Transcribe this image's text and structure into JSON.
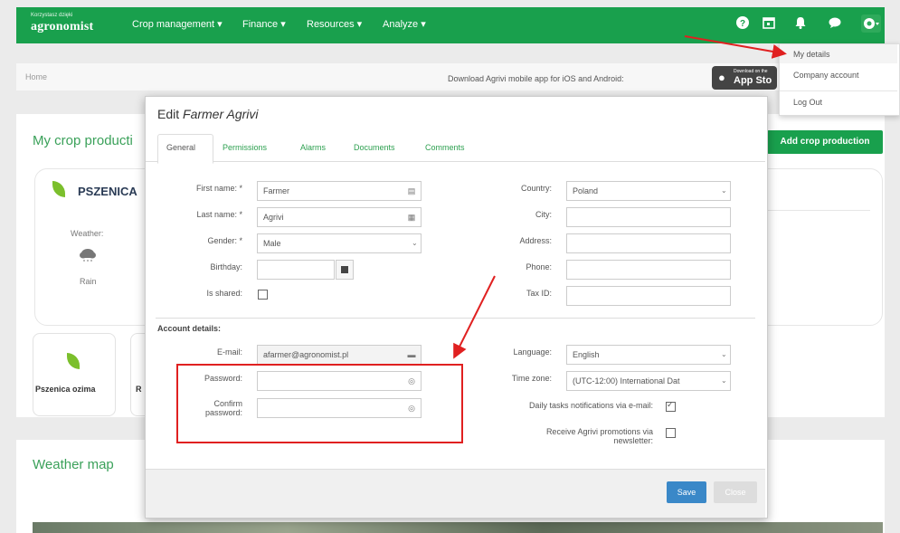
{
  "navbar": {
    "logo_small": "Korzystasz dzięki",
    "logo": "agronomist",
    "items": [
      {
        "label": "Crop management ▾"
      },
      {
        "label": "Finance ▾"
      },
      {
        "label": "Resources ▾"
      },
      {
        "label": "Analyze ▾"
      }
    ],
    "icons": [
      "help-icon",
      "calendar-icon",
      "bell-icon",
      "chat-icon",
      "gear-icon"
    ]
  },
  "user_menu": {
    "items": [
      "My details",
      "Company account",
      "Log Out"
    ]
  },
  "breadcrumb": {
    "home": "Home"
  },
  "download_bar": {
    "text": "Download Agrivi mobile app for iOS and Android:",
    "appstore_small": "Download on the",
    "appstore_label": "App Sto"
  },
  "crops_panel": {
    "title": "My crop producti",
    "add_button": "Add crop production",
    "crop_name": "PSZENICA",
    "weather_label": "Weather:",
    "weather_value": "Rain",
    "tiles": [
      "Pszenica ozima",
      "R"
    ]
  },
  "weather_panel": {
    "title": "Weather map"
  },
  "modal": {
    "title_prefix": "Edit",
    "title_name": "Farmer Agrivi",
    "tabs": [
      "General",
      "Permissions",
      "Alarms",
      "Documents",
      "Comments"
    ],
    "fields": {
      "first_name": {
        "label": "First name: *",
        "value": "Farmer"
      },
      "last_name": {
        "label": "Last name: *",
        "value": "Agrivi"
      },
      "gender": {
        "label": "Gender: *",
        "value": "Male"
      },
      "birthday": {
        "label": "Birthday:",
        "value": ""
      },
      "is_shared": {
        "label": "Is shared:"
      },
      "country": {
        "label": "Country:",
        "value": "Poland"
      },
      "city": {
        "label": "City:",
        "value": ""
      },
      "address": {
        "label": "Address:",
        "value": ""
      },
      "phone": {
        "label": "Phone:",
        "value": ""
      },
      "tax_id": {
        "label": "Tax ID:",
        "value": ""
      }
    },
    "account_title": "Account details:",
    "account": {
      "email": {
        "label": "E-mail:",
        "value": "afarmer@agronomist.pl"
      },
      "password": {
        "label": "Password:",
        "value": ""
      },
      "confirm_label_1": "Confirm",
      "confirm_label_2": "password:",
      "language": {
        "label": "Language:",
        "value": "English"
      },
      "timezone": {
        "label": "Time zone:",
        "value": "(UTC-12:00) International Dat"
      },
      "daily_tasks": {
        "label": "Daily tasks notifications via e-mail:",
        "checked": true
      },
      "promo_1": "Receive Agrivi promotions via",
      "promo_2": "newsletter:"
    },
    "save": "Save",
    "close": "Close"
  },
  "colors": {
    "brand_green": "#19a04d",
    "link_green": "#2da050",
    "save_blue": "#3a88c8",
    "annotation_red": "#e02020"
  }
}
